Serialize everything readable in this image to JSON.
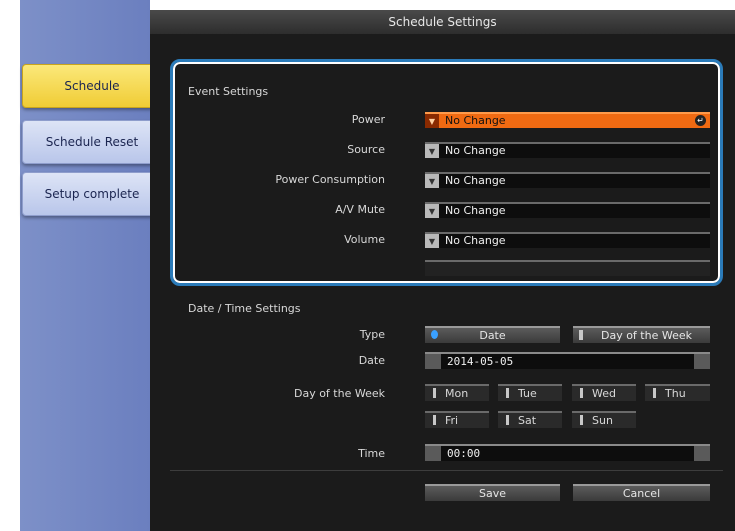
{
  "window": {
    "title": "Schedule Settings"
  },
  "sidebar": {
    "items": [
      {
        "label": "Schedule",
        "active": true
      },
      {
        "label": "Schedule Reset",
        "active": false
      },
      {
        "label": "Setup complete",
        "active": false
      }
    ]
  },
  "event_settings": {
    "title": "Event Settings",
    "rows": [
      {
        "label": "Power",
        "value": "No Change"
      },
      {
        "label": "Source",
        "value": "No Change"
      },
      {
        "label": "Power Consumption",
        "value": "No Change"
      },
      {
        "label": "A/V Mute",
        "value": "No Change"
      },
      {
        "label": "Volume",
        "value": "No Change"
      }
    ]
  },
  "datetime_settings": {
    "title": "Date / Time Settings",
    "type_label": "Type",
    "type_options": [
      "Date",
      "Day of the Week"
    ],
    "type_selected": "Date",
    "date_label": "Date",
    "date_value": "2014-05-05",
    "dow_label": "Day of the Week",
    "days": [
      "Mon",
      "Tue",
      "Wed",
      "Thu",
      "Fri",
      "Sat",
      "Sun"
    ],
    "time_label": "Time",
    "time_value": "00:00"
  },
  "actions": {
    "save": "Save",
    "cancel": "Cancel"
  },
  "colors": {
    "accent": "#f06a12",
    "highlight_border": "#2b7bb9",
    "sidebar_active": "#f5d84a"
  }
}
